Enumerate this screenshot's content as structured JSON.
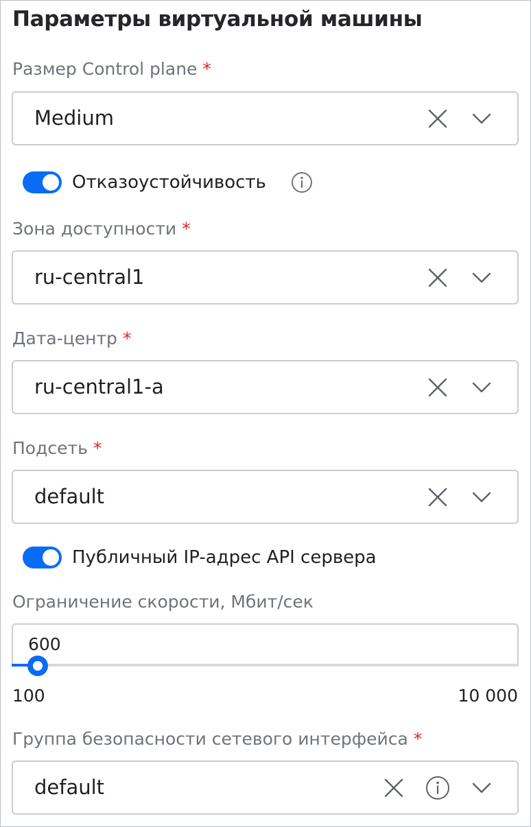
{
  "title": "Параметры виртуальной машины",
  "control_plane": {
    "label": "Размер Control plane",
    "required": "*",
    "value": "Medium"
  },
  "fault_tolerance": {
    "label": "Отказоустойчивость",
    "enabled": true
  },
  "zone": {
    "label": "Зона доступности",
    "required": "*",
    "value": "ru-central1"
  },
  "datacenter": {
    "label": "Дата-центр",
    "required": "*",
    "value": "ru-central1-a"
  },
  "subnet": {
    "label": "Подсеть",
    "required": "*",
    "value": "default"
  },
  "public_ip": {
    "label": "Публичный IP-адрес API сервера",
    "enabled": true
  },
  "speed_limit": {
    "label": "Ограничение скорости, Мбит/сек",
    "value": "600",
    "min_label": "100",
    "max_label": "10 000"
  },
  "security_group": {
    "label": "Группа безопасности сетевого интерфейса",
    "required": "*",
    "value": "default"
  },
  "icons": {
    "clear": "close-icon",
    "expand": "chevron-down-icon",
    "info": "info-icon"
  },
  "colors": {
    "accent": "#0a6cf5",
    "required": "#d8262b",
    "label": "#6f737c",
    "border": "#c9ccd2"
  }
}
